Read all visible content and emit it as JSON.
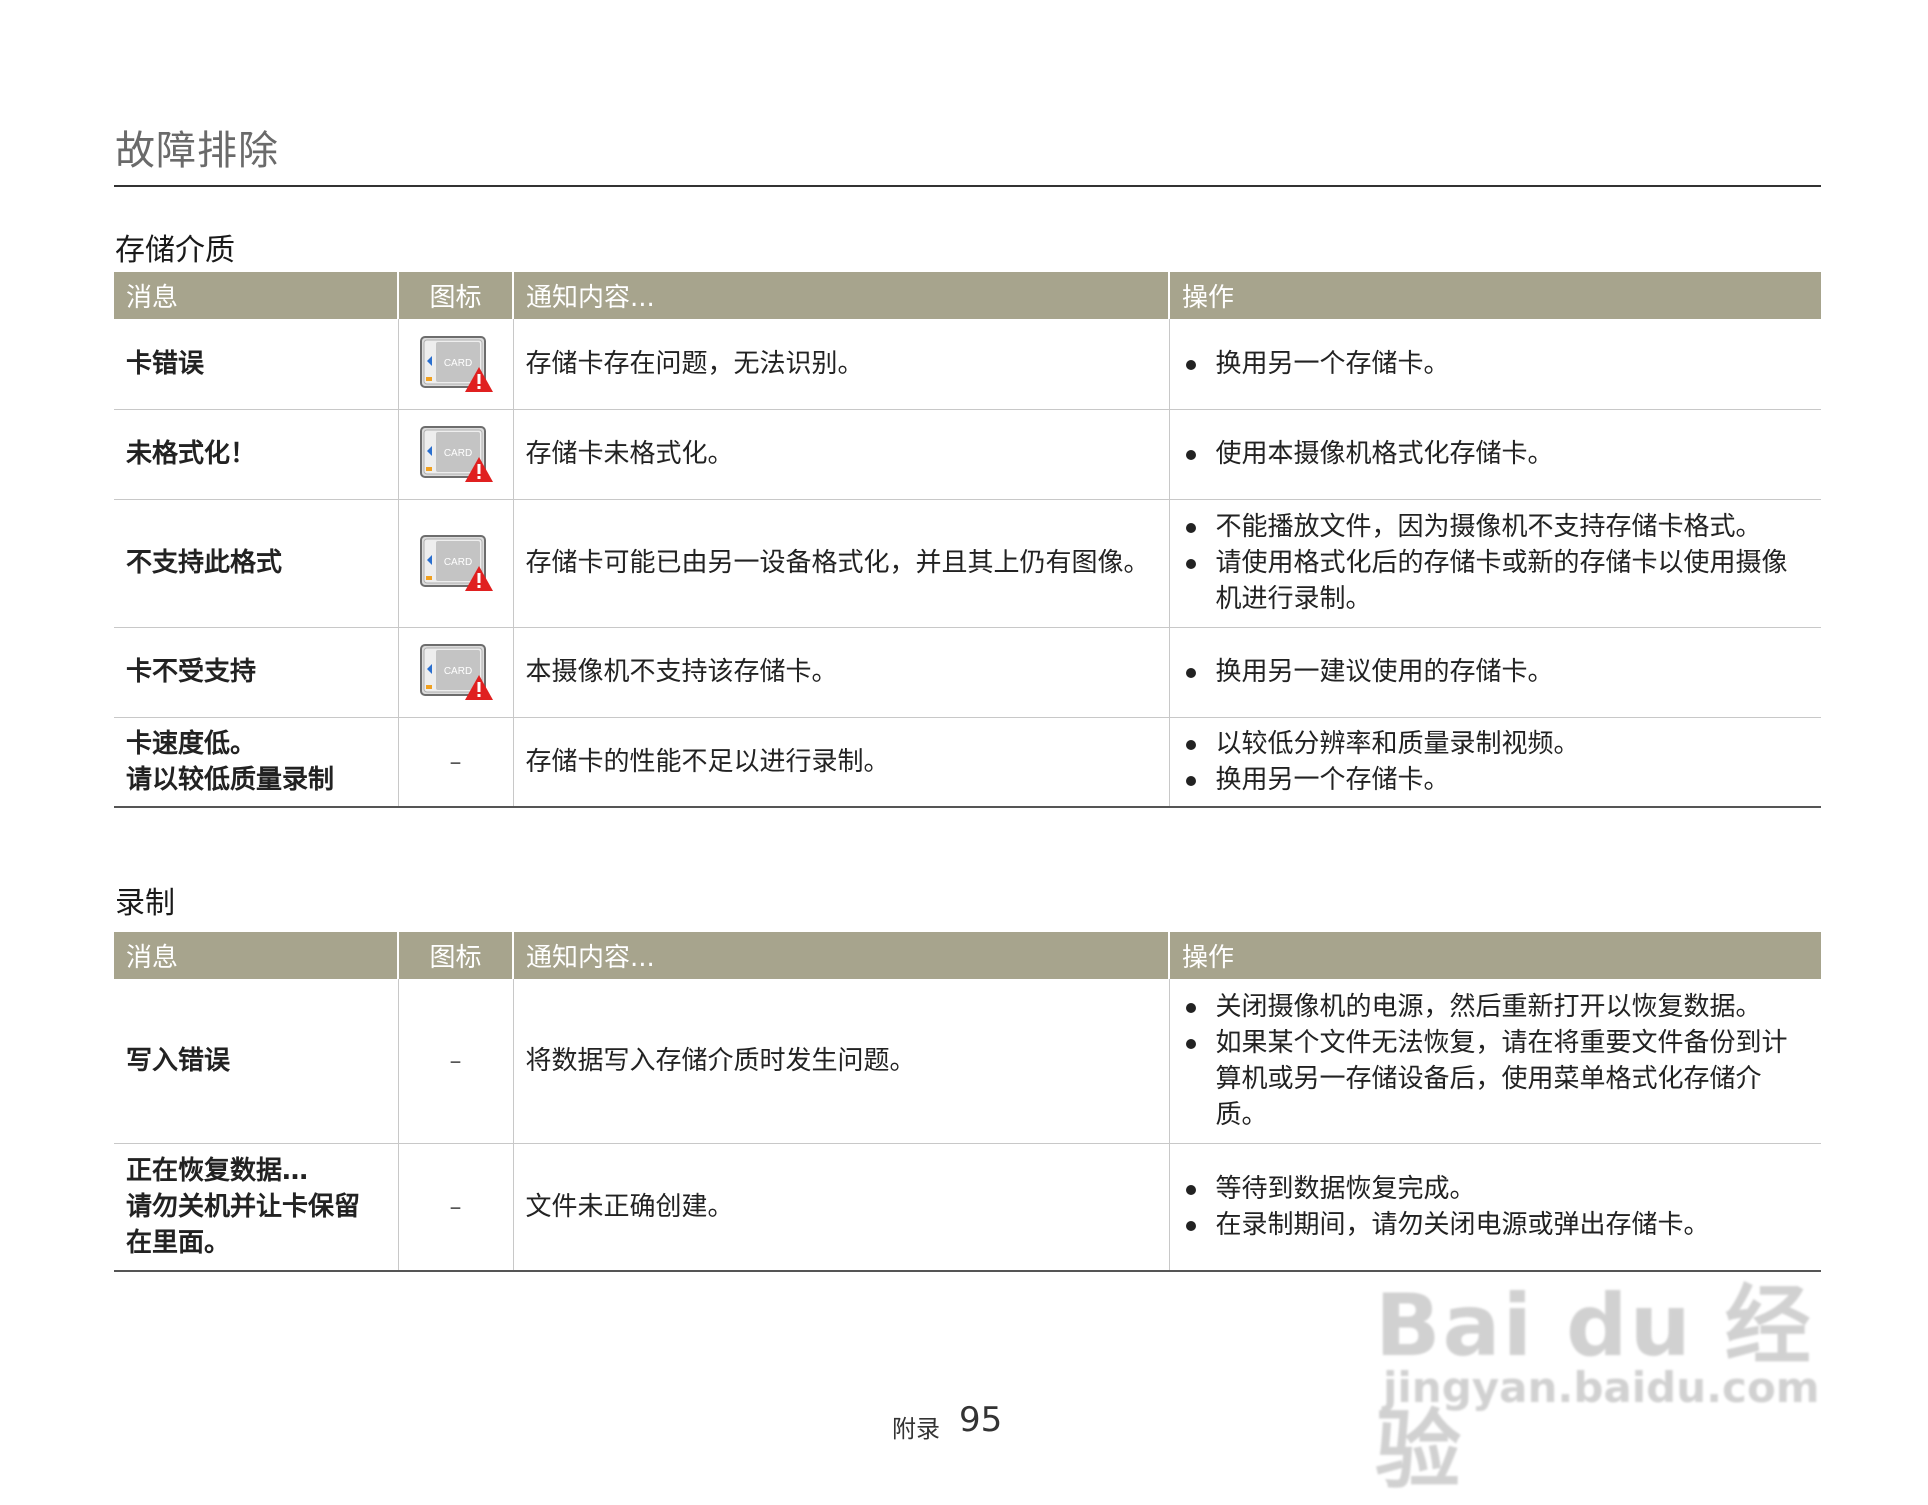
{
  "page": {
    "title": "故障排除",
    "footer_label": "附录",
    "page_number": "95"
  },
  "headers": {
    "message": "消息",
    "icon": "图标",
    "notification": "通知内容...",
    "action": "操作"
  },
  "icons": {
    "card_warning": "card-warning-icon",
    "card_text": "CARD"
  },
  "sections": [
    {
      "title": "存储介质",
      "rows": [
        {
          "message": "卡错误",
          "icon": "card",
          "notification": "存储卡存在问题，无法识别。",
          "actions": [
            "换用另一个存储卡。"
          ]
        },
        {
          "message": "未格式化！",
          "icon": "card",
          "notification": "存储卡未格式化。",
          "actions": [
            "使用本摄像机格式化存储卡。"
          ]
        },
        {
          "message": "不支持此格式",
          "icon": "card",
          "notification": "存储卡可能已由另一设备格式化，并且其上仍有图像。",
          "actions": [
            "不能播放文件，因为摄像机不支持存储卡格式。",
            "请使用格式化后的存储卡或新的存储卡以使用摄像机进行录制。"
          ]
        },
        {
          "message": "卡不受支持",
          "icon": "card",
          "notification": "本摄像机不支持该存储卡。",
          "actions": [
            "换用另一建议使用的存储卡。"
          ]
        },
        {
          "message": "卡速度低。\n请以较低质量录制",
          "icon": "–",
          "notification": "存储卡的性能不足以进行录制。",
          "actions": [
            "以较低分辨率和质量录制视频。",
            "换用另一个存储卡。"
          ]
        }
      ]
    },
    {
      "title": "录制",
      "rows": [
        {
          "message": "写入错误",
          "icon": "–",
          "notification": "将数据写入存储介质时发生问题。",
          "actions": [
            "关闭摄像机的电源，然后重新打开以恢复数据。",
            "如果某个文件无法恢复，请在将重要文件备份到计算机或另一存储设备后，使用菜单格式化存储介质。"
          ]
        },
        {
          "message": "正在恢复数据…\n请勿关机并让卡保留在里面。",
          "icon": "–",
          "notification": "文件未正确创建。",
          "actions": [
            "等待到数据恢复完成。",
            "在录制期间，请勿关闭电源或弹出存储卡。"
          ]
        }
      ]
    }
  ],
  "watermark": {
    "brand": "Bai du 经验",
    "url": "jingyan.baidu.com"
  },
  "colors": {
    "header_bg": "#a7a48d",
    "warning_red": "#e02020"
  }
}
